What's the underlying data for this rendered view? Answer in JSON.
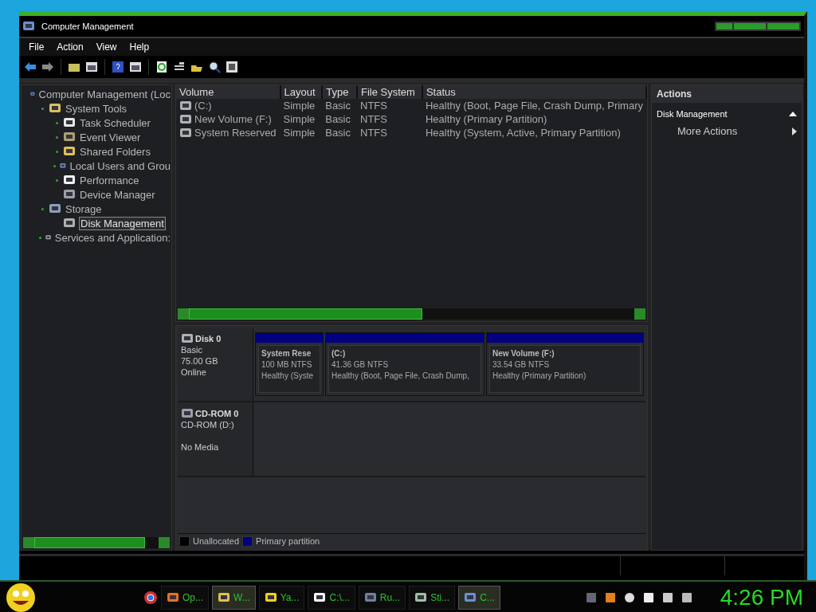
{
  "window": {
    "title": "Computer Management"
  },
  "menu": [
    "File",
    "Action",
    "View",
    "Help"
  ],
  "tree": [
    {
      "label": "Computer Management (Loc",
      "expandable": false,
      "selected": false,
      "children": [
        {
          "label": "System Tools",
          "expandable": true,
          "selected": false,
          "children": [
            {
              "label": "Task Scheduler",
              "expandable": true,
              "selected": false
            },
            {
              "label": "Event Viewer",
              "expandable": true,
              "selected": false
            },
            {
              "label": "Shared Folders",
              "expandable": true,
              "selected": false
            },
            {
              "label": "Local Users and Grou",
              "expandable": true,
              "selected": false
            },
            {
              "label": "Performance",
              "expandable": true,
              "selected": false
            },
            {
              "label": "Device Manager",
              "expandable": false,
              "selected": false
            }
          ]
        },
        {
          "label": "Storage",
          "expandable": true,
          "selected": false,
          "children": [
            {
              "label": "Disk Management",
              "expandable": false,
              "selected": true
            }
          ]
        },
        {
          "label": "Services and Application:",
          "expandable": true,
          "selected": false
        }
      ]
    }
  ],
  "volumes": {
    "columns": [
      "Volume",
      "Layout",
      "Type",
      "File System",
      "Status"
    ],
    "rows": [
      [
        "(C:)",
        "Simple",
        "Basic",
        "NTFS",
        "Healthy (Boot, Page File, Crash Dump, Primary"
      ],
      [
        "New Volume (F:)",
        "Simple",
        "Basic",
        "NTFS",
        "Healthy (Primary Partition)"
      ],
      [
        "System Reserved",
        "Simple",
        "Basic",
        "NTFS",
        "Healthy (System, Active, Primary Partition)"
      ]
    ]
  },
  "disks": [
    {
      "kind": "disk",
      "name": "Disk 0",
      "lines": [
        "Basic",
        "75.00 GB",
        "Online"
      ],
      "partitions": [
        {
          "name": "System Rese",
          "size": "100 MB NTFS",
          "status": "Healthy (Syste",
          "color": "#000080"
        },
        {
          "name": "(C:)",
          "size": "41.36 GB NTFS",
          "status": "Healthy (Boot, Page File, Crash Dump,",
          "color": "#000080"
        },
        {
          "name": "New Volume  (F:)",
          "size": "33.54 GB NTFS",
          "status": "Healthy (Primary Partition)",
          "color": "#000080"
        }
      ]
    },
    {
      "kind": "cdrom",
      "name": "CD-ROM 0",
      "lines": [
        "CD-ROM (D:)",
        "No Media"
      ]
    }
  ],
  "legend": [
    {
      "label": "Unallocated",
      "color": "#000000"
    },
    {
      "label": "Primary partition",
      "color": "#000080"
    }
  ],
  "actions": {
    "title": "Actions",
    "sections": [
      {
        "label": "Disk Management",
        "expanded": true,
        "items": [
          "More Actions"
        ]
      }
    ]
  },
  "taskbar": {
    "items": [
      {
        "label": "Op...",
        "selected": false
      },
      {
        "label": "W...",
        "selected": true
      },
      {
        "label": "Ya...",
        "selected": false
      },
      {
        "label": "C:\\...",
        "selected": false
      },
      {
        "label": "Ru...",
        "selected": false
      },
      {
        "label": "Sti...",
        "selected": false
      },
      {
        "label": "C...",
        "selected": true
      }
    ],
    "clock": "4:26 PM"
  }
}
